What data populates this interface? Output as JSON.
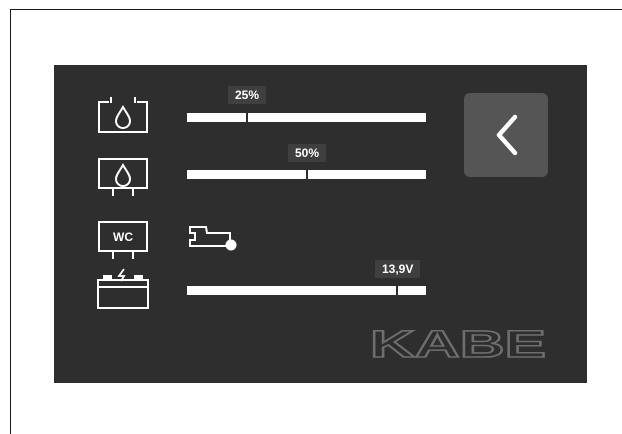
{
  "colors": {
    "panel_bg": "#2e2e2e",
    "bar_fill": "#ffffff",
    "bubble_bg": "#3f3f3f",
    "button_bg": "#555555",
    "logo_color": "#6e6e6e"
  },
  "fresh_water": {
    "icon": "fresh-water-tank-icon",
    "level_percent": 25,
    "label": "25%"
  },
  "grey_water": {
    "icon": "grey-water-tank-icon",
    "level_percent": 50,
    "label": "50%"
  },
  "wc": {
    "icon": "wc-tank-icon",
    "tank_label": "WC",
    "status_icon": "cassette-status-icon"
  },
  "battery": {
    "icon": "battery-icon",
    "level_percent": 88,
    "label": "13,9V"
  },
  "back_button": {
    "icon": "chevron-left-icon"
  },
  "logo": {
    "text": "KABE"
  }
}
